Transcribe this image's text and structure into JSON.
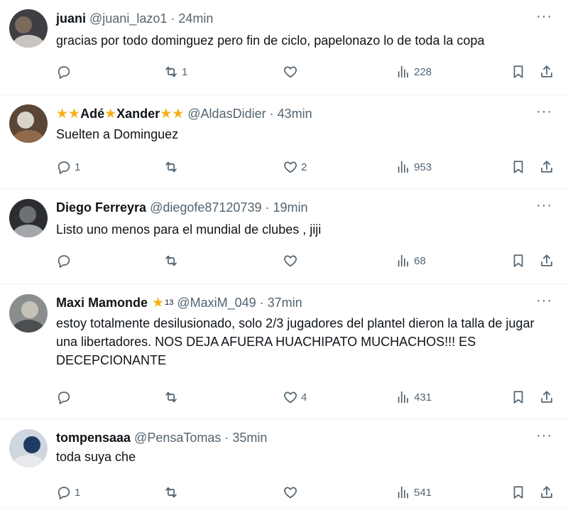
{
  "tweets": [
    {
      "name": "juani",
      "name_before": "",
      "name_after": "",
      "handle": "@juani_lazo1",
      "time": "24min",
      "text": "gracias por todo dominguez pero fin de ciclo, papelonazo lo de toda la copa",
      "replies": "",
      "retweets": "1",
      "likes": "",
      "views": "228"
    },
    {
      "name": "Adé",
      "name_before": "",
      "name_after": "Xander",
      "handle": "@AldasDidier",
      "time": "43min",
      "text": "Suelten a Dominguez",
      "replies": "1",
      "retweets": "",
      "likes": "2",
      "views": "953"
    },
    {
      "name": "Diego Ferreyra",
      "handle": "@diegofe87120739",
      "time": "19min",
      "text": "Listo uno menos para el mundial de clubes , jiji",
      "replies": "",
      "retweets": "",
      "likes": "",
      "views": "68"
    },
    {
      "name": "Maxi Mamonde",
      "badge_number": "13",
      "handle": "@MaxiM_049",
      "time": "37min",
      "text": "estoy totalmente desilusionado, solo 2/3 jugadores del plantel dieron la talla de jugar una libertadores. NOS DEJA AFUERA HUACHIPATO MUCHACHOS!!! ES DECEPCIONANTE",
      "replies": "",
      "retweets": "",
      "likes": "4",
      "views": "431"
    },
    {
      "name": "tompensaaa",
      "handle": "@PensaTomas",
      "time": "35min",
      "text": "toda suya che",
      "replies": "1",
      "retweets": "",
      "likes": "",
      "views": "541"
    }
  ],
  "separator_dot": "·",
  "more_glyph": "···",
  "star_glyph": "★",
  "icons": [
    "reply-icon",
    "retweet-icon",
    "like-icon",
    "views-icon",
    "bookmark-icon",
    "share-icon",
    "more-icon",
    "star-emoji-icon"
  ],
  "colors": {
    "text": "#0f1419",
    "secondary": "#536471",
    "star": "#f6b016",
    "divider": "#eff3f4"
  }
}
